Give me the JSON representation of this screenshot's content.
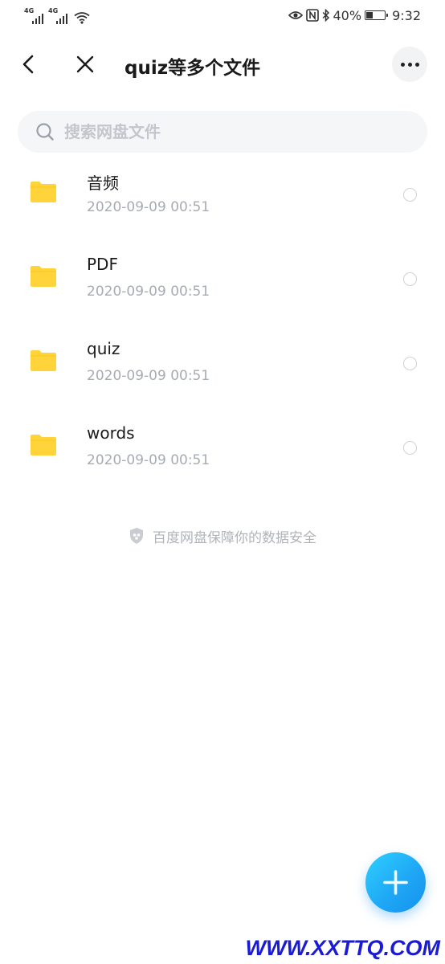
{
  "status_bar": {
    "left_icons": [
      {
        "label": "4G",
        "icon": "signal-icon"
      },
      {
        "label": "4G",
        "icon": "signal-icon"
      },
      {
        "icon": "wifi-icon"
      }
    ],
    "right_icons": [
      "eye-icon",
      "nfc-icon",
      "bluetooth-icon"
    ],
    "battery_percent": "40%",
    "battery_level": 0.4,
    "time": "9:32"
  },
  "header": {
    "title": "quiz等多个文件",
    "back_icon": "chevron-left-icon",
    "close_icon": "close-icon",
    "more_icon": "more-icon"
  },
  "search": {
    "placeholder": "搜索网盘文件",
    "value": ""
  },
  "files": [
    {
      "name": "音频",
      "date": "2020-09-09  00:51",
      "type": "folder"
    },
    {
      "name": "PDF",
      "date": "2020-09-09  00:51",
      "type": "folder"
    },
    {
      "name": "quiz",
      "date": "2020-09-09  00:51",
      "type": "folder"
    },
    {
      "name": "words",
      "date": "2020-09-09  00:51",
      "type": "folder"
    }
  ],
  "footer_note": "百度网盘保障你的数据安全",
  "fab": {
    "icon": "plus-icon"
  },
  "watermark": "WWW.XXTTQ.COM",
  "colors": {
    "accent": "#1fa8f5",
    "folder": "#ffd43b",
    "muted_text": "#a7abb3",
    "watermark": "#1b1bd6"
  }
}
